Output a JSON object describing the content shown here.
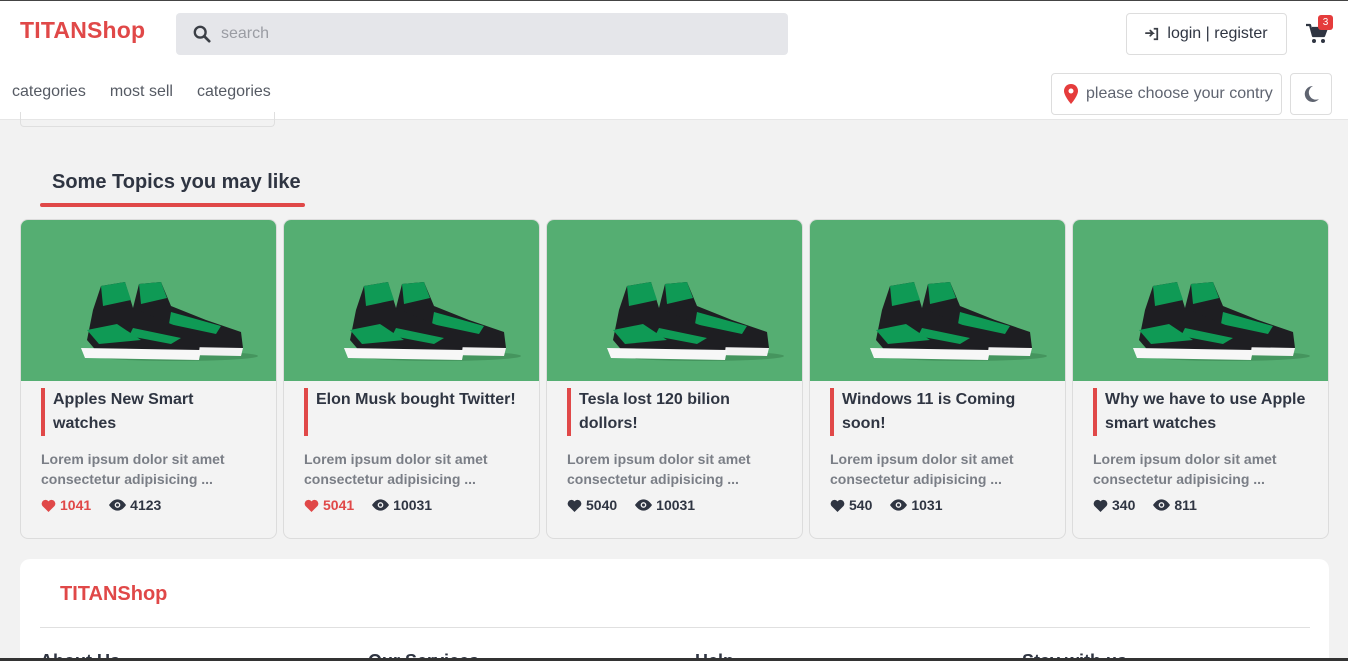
{
  "header": {
    "logo": "TITANShop",
    "search_placeholder": "search",
    "login_label": "login | register",
    "cart_count": "3",
    "nav": [
      "categories",
      "most sell",
      "categories"
    ],
    "country_placeholder": "please choose your contry"
  },
  "section": {
    "title": "Some Topics you may like"
  },
  "cards": [
    {
      "title": "Apples New Smart watches",
      "desc": "Lorem ipsum dolor sit amet consectetur adipisicing ...",
      "likes": "1041",
      "views": "4123",
      "liked": true
    },
    {
      "title": "Elon Musk bought Twitter!",
      "desc": "Lorem ipsum dolor sit amet consectetur adipisicing ...",
      "likes": "5041",
      "views": "10031",
      "liked": true
    },
    {
      "title": "Tesla lost 120 bilion dollors!",
      "desc": "Lorem ipsum dolor sit amet consectetur adipisicing ...",
      "likes": "5040",
      "views": "10031",
      "liked": false
    },
    {
      "title": "Windows 11 is Coming soon!",
      "desc": "Lorem ipsum dolor sit amet consectetur adipisicing ...",
      "likes": "540",
      "views": "1031",
      "liked": false
    },
    {
      "title": "Why we have to use Apple smart watches",
      "desc": "Lorem ipsum dolor sit amet consectetur adipisicing ...",
      "likes": "340",
      "views": "811",
      "liked": false
    }
  ],
  "footer": {
    "logo": "TITANShop",
    "columns": [
      "About Us",
      "Our Services",
      "Help",
      "Stay with us"
    ]
  },
  "colors": {
    "brand": "#e04848",
    "card_image_bg": "#55ae72"
  },
  "icons": {
    "search": "search-icon",
    "login": "sign-in-icon",
    "cart": "cart-icon",
    "country": "map-pin-icon",
    "theme": "moon-icon",
    "like": "heart-icon",
    "views": "eye-icon"
  }
}
